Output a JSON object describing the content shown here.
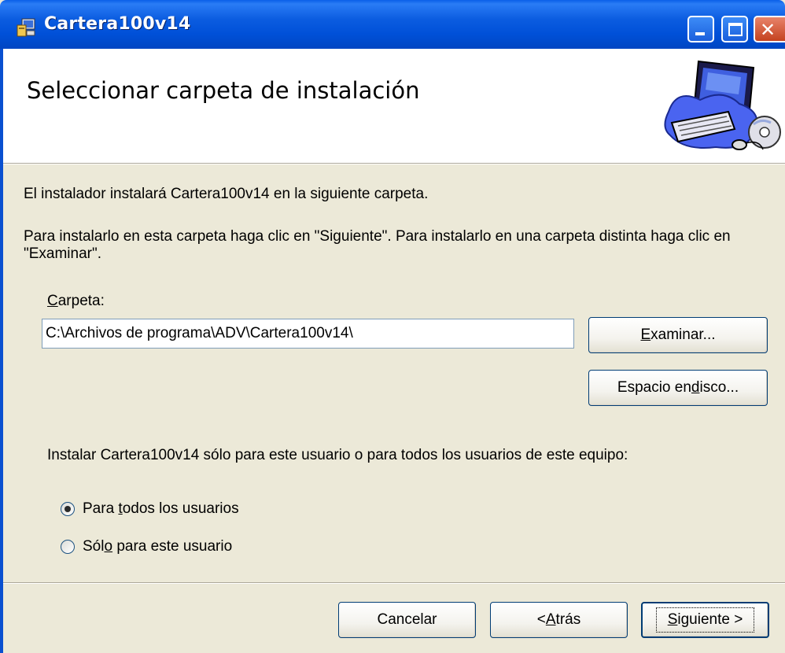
{
  "window": {
    "title": "Cartera100v14",
    "controls": [
      "minimize-icon",
      "maximize-icon",
      "close-icon"
    ]
  },
  "header": {
    "title": "Seleccionar carpeta de instalación",
    "art": "computer-cd-illustration"
  },
  "body": {
    "intro": "El instalador instalará Cartera100v14 en la siguiente carpeta.",
    "instructions": "Para instalarlo en esta carpeta haga clic en \"Siguiente\". Para instalarlo en una carpeta distinta haga clic en \"Examinar\".",
    "folder_label_accel": "C",
    "folder_label_rest": "arpeta:",
    "folder_value": "C:\\Archivos de programa\\ADV\\Cartera100v14\\",
    "browse_accel": "E",
    "browse_rest": "xaminar...",
    "disk_space_pre": "Espacio en ",
    "disk_space_accel": "d",
    "disk_space_post": "isco...",
    "scope_question": "Instalar Cartera100v14 sólo para este usuario o para todos los usuarios de este equipo:",
    "radio_all_pre": "Para ",
    "radio_all_accel": "t",
    "radio_all_post": "odos los usuarios",
    "radio_all_checked": true,
    "radio_me_pre": "Sól",
    "radio_me_accel": "o",
    "radio_me_post": " para este usuario",
    "radio_me_checked": false
  },
  "footer": {
    "cancel_label": "Cancelar",
    "back_pre": "< ",
    "back_accel": "A",
    "back_post": "trás",
    "next_accel": "S",
    "next_post": "iguiente >"
  },
  "colors": {
    "titlebar": "#0054e3",
    "dialog_bg": "#ece9d8",
    "button_border": "#003c74"
  }
}
